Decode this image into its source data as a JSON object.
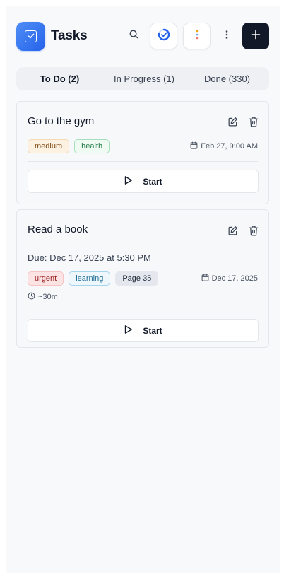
{
  "header": {
    "title": "Tasks",
    "icons": [
      "check-square-icon",
      "search-icon",
      "progress-ring-icon",
      "palette-icon",
      "more-vertical-icon",
      "plus-icon"
    ]
  },
  "tabs": [
    {
      "label": "To Do (2)",
      "active": true
    },
    {
      "label": "In Progress (1)",
      "active": false
    },
    {
      "label": "Done (330)",
      "active": false
    }
  ],
  "tasks": [
    {
      "title": "Go to the gym",
      "tags": [
        "medium",
        "health"
      ],
      "date": "Feb 27, 9:00 AM",
      "start_label": "Start"
    },
    {
      "title": "Read a book",
      "due": "Due: Dec 17, 2025 at 5:30 PM",
      "tags": [
        "urgent",
        "learning",
        "Page 35"
      ],
      "date": "Dec 17, 2025",
      "estimate": "~30m",
      "start_label": "Start"
    }
  ],
  "colors": {
    "accent": "#2563eb",
    "primary_button": "#111827",
    "background": "#f8f9fb"
  }
}
